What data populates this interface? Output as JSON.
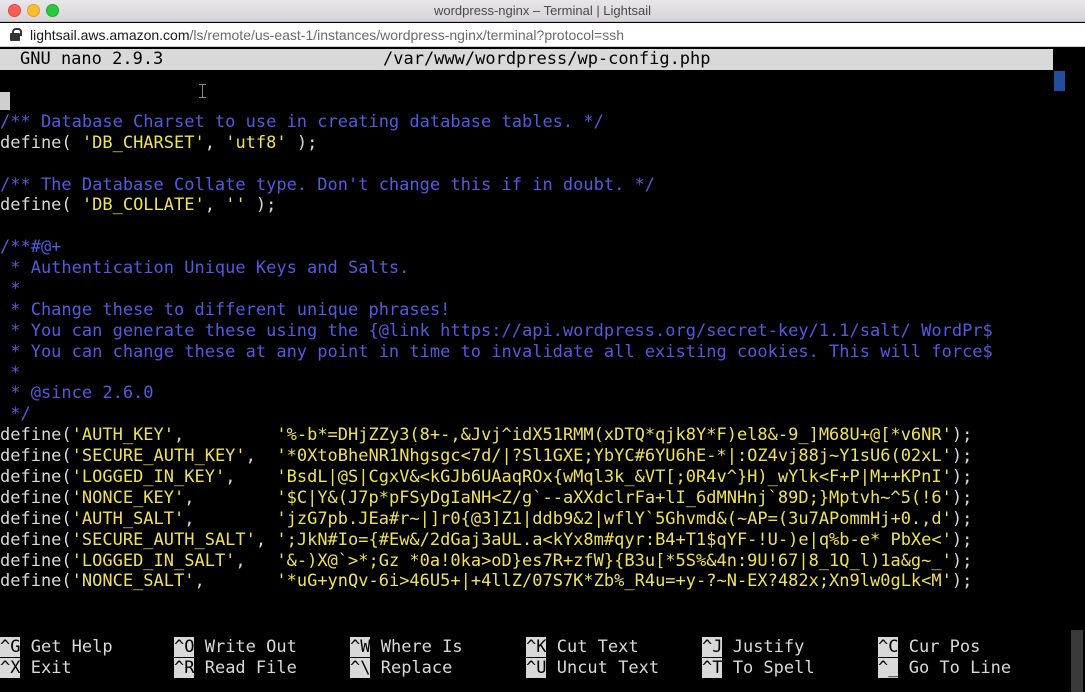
{
  "window": {
    "title": "wordpress-nginx – Terminal | Lightsail"
  },
  "address_bar": {
    "host": "lightsail.aws.amazon.com",
    "path": "/ls/remote/us-east-1/instances/wordpress-nginx/terminal?protocol=ssh"
  },
  "nano": {
    "version": "GNU nano 2.9.3",
    "filename": "/var/www/wordpress/wp-config.php"
  },
  "lines": [
    [],
    [
      [
        "comment",
        "/** Database Charset to use in creating database tables. */"
      ]
    ],
    [
      [
        "plain",
        "define( "
      ],
      [
        "str",
        "'DB_CHARSET'"
      ],
      [
        "plain",
        ", "
      ],
      [
        "str",
        "'utf8'"
      ],
      [
        "plain",
        " );"
      ]
    ],
    [],
    [
      [
        "comment",
        "/** The Database Collate type. Don't change this if in doubt. */"
      ]
    ],
    [
      [
        "plain",
        "define( "
      ],
      [
        "str",
        "'DB_COLLATE'"
      ],
      [
        "plain",
        ", "
      ],
      [
        "str",
        "''"
      ],
      [
        "plain",
        " );"
      ]
    ],
    [],
    [
      [
        "comment",
        "/**#@+"
      ]
    ],
    [
      [
        "comment",
        " * Authentication Unique Keys and Salts."
      ]
    ],
    [
      [
        "comment",
        " *"
      ]
    ],
    [
      [
        "comment",
        " * Change these to different unique phrases!"
      ]
    ],
    [
      [
        "comment",
        " * You can generate these using the {@link https://api.wordpress.org/secret-key/1.1/salt/ WordPr$"
      ]
    ],
    [
      [
        "comment",
        " * You can change these at any point in time to invalidate all existing cookies. This will force$"
      ]
    ],
    [
      [
        "comment",
        " *"
      ]
    ],
    [
      [
        "comment",
        " * @since 2.6.0"
      ]
    ],
    [
      [
        "comment",
        " */"
      ]
    ],
    [
      [
        "plain",
        "define("
      ],
      [
        "str",
        "'AUTH_KEY'"
      ],
      [
        "plain",
        ",         "
      ],
      [
        "str",
        "'%-b*=DHjZZy3(8+-,&Jvj^idX51RMM(xDTQ*qjk8Y*F)el8&-9_]M68U+@[*v6NR'"
      ],
      [
        "plain",
        ");"
      ]
    ],
    [
      [
        "plain",
        "define("
      ],
      [
        "str",
        "'SECURE_AUTH_KEY'"
      ],
      [
        "plain",
        ",  "
      ],
      [
        "str",
        "'*0XtoBheNR1Nhgsgc<7d/|?Sl1GXE;YbYC#6YU6hE-*|:OZ4vj88j~Y1sU6(02xL'"
      ],
      [
        "plain",
        ");"
      ]
    ],
    [
      [
        "plain",
        "define("
      ],
      [
        "str",
        "'LOGGED_IN_KEY'"
      ],
      [
        "plain",
        ",    "
      ],
      [
        "str",
        "'BsdL|@S|CgxV&<kGJb6UAaqROx{wMql3k_&VT[;0R4v^}H)_wYlk<F+P|M++KPnI'"
      ],
      [
        "plain",
        ");"
      ]
    ],
    [
      [
        "plain",
        "define("
      ],
      [
        "str",
        "'NONCE_KEY'"
      ],
      [
        "plain",
        ",        "
      ],
      [
        "str",
        "'$C|Y&(J7p*pFSyDgIaNH<Z/g`--aXXdclrFa+lI_6dMNHnj`89D;}Mptvh~^5(!6'"
      ],
      [
        "plain",
        ");"
      ]
    ],
    [
      [
        "plain",
        "define("
      ],
      [
        "str",
        "'AUTH_SALT'"
      ],
      [
        "plain",
        ",        "
      ],
      [
        "str",
        "'jzG7pb.JEa#r~|]r0{@3]Z1|ddb9&2|wflY`5Ghvmd&(~AP=(3u7APommHj+0.,d'"
      ],
      [
        "plain",
        ");"
      ]
    ],
    [
      [
        "plain",
        "define("
      ],
      [
        "str",
        "'SECURE_AUTH_SALT'"
      ],
      [
        "plain",
        ", "
      ],
      [
        "str",
        "';JkN#Io={#Ew&/2dGaj3aUL.a<kYx8m#qyr:B4+T1$qYF-!U-)e|q%b-e* PbXe<'"
      ],
      [
        "plain",
        ");"
      ]
    ],
    [
      [
        "plain",
        "define("
      ],
      [
        "str",
        "'LOGGED_IN_SALT'"
      ],
      [
        "plain",
        ",   "
      ],
      [
        "str",
        "'&-)X@`>*;Gz *0a!0ka>oD}es7R+zfW}{B3u[*5S%&4n:9U!67|8_1Q_l)1a&g~_'"
      ],
      [
        "plain",
        ");"
      ]
    ],
    [
      [
        "plain",
        "define("
      ],
      [
        "str",
        "'NONCE_SALT'"
      ],
      [
        "plain",
        ",       "
      ],
      [
        "str",
        "'*uG+ynQv-6i>46U5+|+4llZ/07S7K*Zb%_R4u=+y-?~N-EX?482x;Xn9lw0gLk<M'"
      ],
      [
        "plain",
        ");"
      ]
    ]
  ],
  "shortcuts": [
    {
      "key": "^G",
      "label": " Get Help"
    },
    {
      "key": "^O",
      "label": " Write Out"
    },
    {
      "key": "^W",
      "label": " Where Is"
    },
    {
      "key": "^K",
      "label": " Cut Text"
    },
    {
      "key": "^J",
      "label": " Justify"
    },
    {
      "key": "^C",
      "label": " Cur Pos"
    },
    {
      "key": "^X",
      "label": " Exit"
    },
    {
      "key": "^R",
      "label": " Read File"
    },
    {
      "key": "^\\",
      "label": " Replace"
    },
    {
      "key": "^U",
      "label": " Uncut Text"
    },
    {
      "key": "^T",
      "label": " To Spell"
    },
    {
      "key": "^_",
      "label": " Go To Line"
    }
  ],
  "colors": {
    "comment": "#4f5ce0",
    "string": "#efe15c",
    "text": "#d9d9d9",
    "background": "#000000"
  }
}
